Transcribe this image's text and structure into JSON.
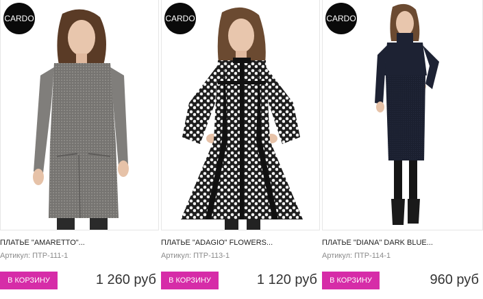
{
  "products": [
    {
      "brand_logo": "CARDO",
      "title": "ПЛАТЬЕ \"AMARETTO\"...",
      "sku": "Артикул: ПТР-111-1",
      "button": "В КОРЗИНУ",
      "price": "1 260 руб",
      "dress_color": "#7d7b78"
    },
    {
      "brand_logo": "CARDO",
      "title": "ПЛАТЬЕ \"ADAGIO\" FLOWERS...",
      "sku": "Артикул: ПТР-113-1",
      "button": "В КОРЗИНУ",
      "price": "1 120 руб",
      "dress_color": "#2a2a2a"
    },
    {
      "brand_logo": "CARDO",
      "title": "ПЛАТЬЕ \"DIANA\" DARK BLUE...",
      "sku": "Артикул: ПТР-114-1",
      "button": "В КОРЗИНУ",
      "price": "960 руб",
      "dress_color": "#1d2233"
    }
  ],
  "colors": {
    "accent": "#d62ca8",
    "logo_bg": "#0a0a0a"
  }
}
